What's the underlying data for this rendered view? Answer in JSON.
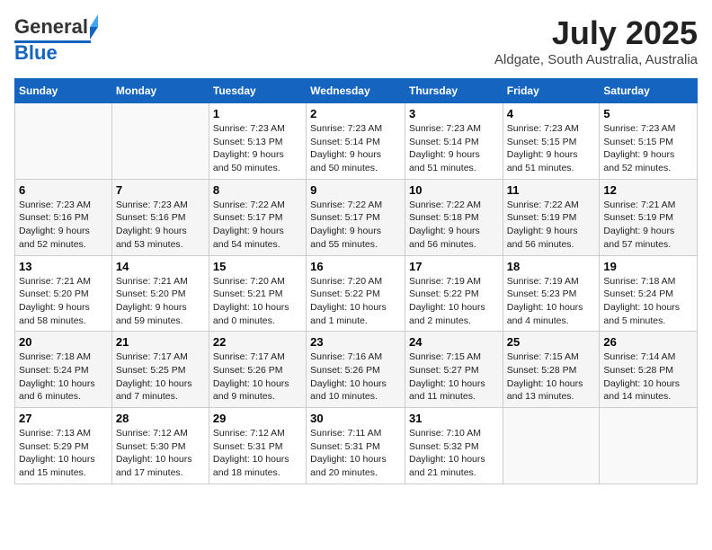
{
  "header": {
    "logo_general": "General",
    "logo_blue": "Blue",
    "month_year": "July 2025",
    "location": "Aldgate, South Australia, Australia"
  },
  "weekdays": [
    "Sunday",
    "Monday",
    "Tuesday",
    "Wednesday",
    "Thursday",
    "Friday",
    "Saturday"
  ],
  "weeks": [
    [
      {
        "day": "",
        "info": ""
      },
      {
        "day": "",
        "info": ""
      },
      {
        "day": "1",
        "info": "Sunrise: 7:23 AM\nSunset: 5:13 PM\nDaylight: 9 hours\nand 50 minutes."
      },
      {
        "day": "2",
        "info": "Sunrise: 7:23 AM\nSunset: 5:14 PM\nDaylight: 9 hours\nand 50 minutes."
      },
      {
        "day": "3",
        "info": "Sunrise: 7:23 AM\nSunset: 5:14 PM\nDaylight: 9 hours\nand 51 minutes."
      },
      {
        "day": "4",
        "info": "Sunrise: 7:23 AM\nSunset: 5:15 PM\nDaylight: 9 hours\nand 51 minutes."
      },
      {
        "day": "5",
        "info": "Sunrise: 7:23 AM\nSunset: 5:15 PM\nDaylight: 9 hours\nand 52 minutes."
      }
    ],
    [
      {
        "day": "6",
        "info": "Sunrise: 7:23 AM\nSunset: 5:16 PM\nDaylight: 9 hours\nand 52 minutes."
      },
      {
        "day": "7",
        "info": "Sunrise: 7:23 AM\nSunset: 5:16 PM\nDaylight: 9 hours\nand 53 minutes."
      },
      {
        "day": "8",
        "info": "Sunrise: 7:22 AM\nSunset: 5:17 PM\nDaylight: 9 hours\nand 54 minutes."
      },
      {
        "day": "9",
        "info": "Sunrise: 7:22 AM\nSunset: 5:17 PM\nDaylight: 9 hours\nand 55 minutes."
      },
      {
        "day": "10",
        "info": "Sunrise: 7:22 AM\nSunset: 5:18 PM\nDaylight: 9 hours\nand 56 minutes."
      },
      {
        "day": "11",
        "info": "Sunrise: 7:22 AM\nSunset: 5:19 PM\nDaylight: 9 hours\nand 56 minutes."
      },
      {
        "day": "12",
        "info": "Sunrise: 7:21 AM\nSunset: 5:19 PM\nDaylight: 9 hours\nand 57 minutes."
      }
    ],
    [
      {
        "day": "13",
        "info": "Sunrise: 7:21 AM\nSunset: 5:20 PM\nDaylight: 9 hours\nand 58 minutes."
      },
      {
        "day": "14",
        "info": "Sunrise: 7:21 AM\nSunset: 5:20 PM\nDaylight: 9 hours\nand 59 minutes."
      },
      {
        "day": "15",
        "info": "Sunrise: 7:20 AM\nSunset: 5:21 PM\nDaylight: 10 hours\nand 0 minutes."
      },
      {
        "day": "16",
        "info": "Sunrise: 7:20 AM\nSunset: 5:22 PM\nDaylight: 10 hours\nand 1 minute."
      },
      {
        "day": "17",
        "info": "Sunrise: 7:19 AM\nSunset: 5:22 PM\nDaylight: 10 hours\nand 2 minutes."
      },
      {
        "day": "18",
        "info": "Sunrise: 7:19 AM\nSunset: 5:23 PM\nDaylight: 10 hours\nand 4 minutes."
      },
      {
        "day": "19",
        "info": "Sunrise: 7:18 AM\nSunset: 5:24 PM\nDaylight: 10 hours\nand 5 minutes."
      }
    ],
    [
      {
        "day": "20",
        "info": "Sunrise: 7:18 AM\nSunset: 5:24 PM\nDaylight: 10 hours\nand 6 minutes."
      },
      {
        "day": "21",
        "info": "Sunrise: 7:17 AM\nSunset: 5:25 PM\nDaylight: 10 hours\nand 7 minutes."
      },
      {
        "day": "22",
        "info": "Sunrise: 7:17 AM\nSunset: 5:26 PM\nDaylight: 10 hours\nand 9 minutes."
      },
      {
        "day": "23",
        "info": "Sunrise: 7:16 AM\nSunset: 5:26 PM\nDaylight: 10 hours\nand 10 minutes."
      },
      {
        "day": "24",
        "info": "Sunrise: 7:15 AM\nSunset: 5:27 PM\nDaylight: 10 hours\nand 11 minutes."
      },
      {
        "day": "25",
        "info": "Sunrise: 7:15 AM\nSunset: 5:28 PM\nDaylight: 10 hours\nand 13 minutes."
      },
      {
        "day": "26",
        "info": "Sunrise: 7:14 AM\nSunset: 5:28 PM\nDaylight: 10 hours\nand 14 minutes."
      }
    ],
    [
      {
        "day": "27",
        "info": "Sunrise: 7:13 AM\nSunset: 5:29 PM\nDaylight: 10 hours\nand 15 minutes."
      },
      {
        "day": "28",
        "info": "Sunrise: 7:12 AM\nSunset: 5:30 PM\nDaylight: 10 hours\nand 17 minutes."
      },
      {
        "day": "29",
        "info": "Sunrise: 7:12 AM\nSunset: 5:31 PM\nDaylight: 10 hours\nand 18 minutes."
      },
      {
        "day": "30",
        "info": "Sunrise: 7:11 AM\nSunset: 5:31 PM\nDaylight: 10 hours\nand 20 minutes."
      },
      {
        "day": "31",
        "info": "Sunrise: 7:10 AM\nSunset: 5:32 PM\nDaylight: 10 hours\nand 21 minutes."
      },
      {
        "day": "",
        "info": ""
      },
      {
        "day": "",
        "info": ""
      }
    ]
  ]
}
